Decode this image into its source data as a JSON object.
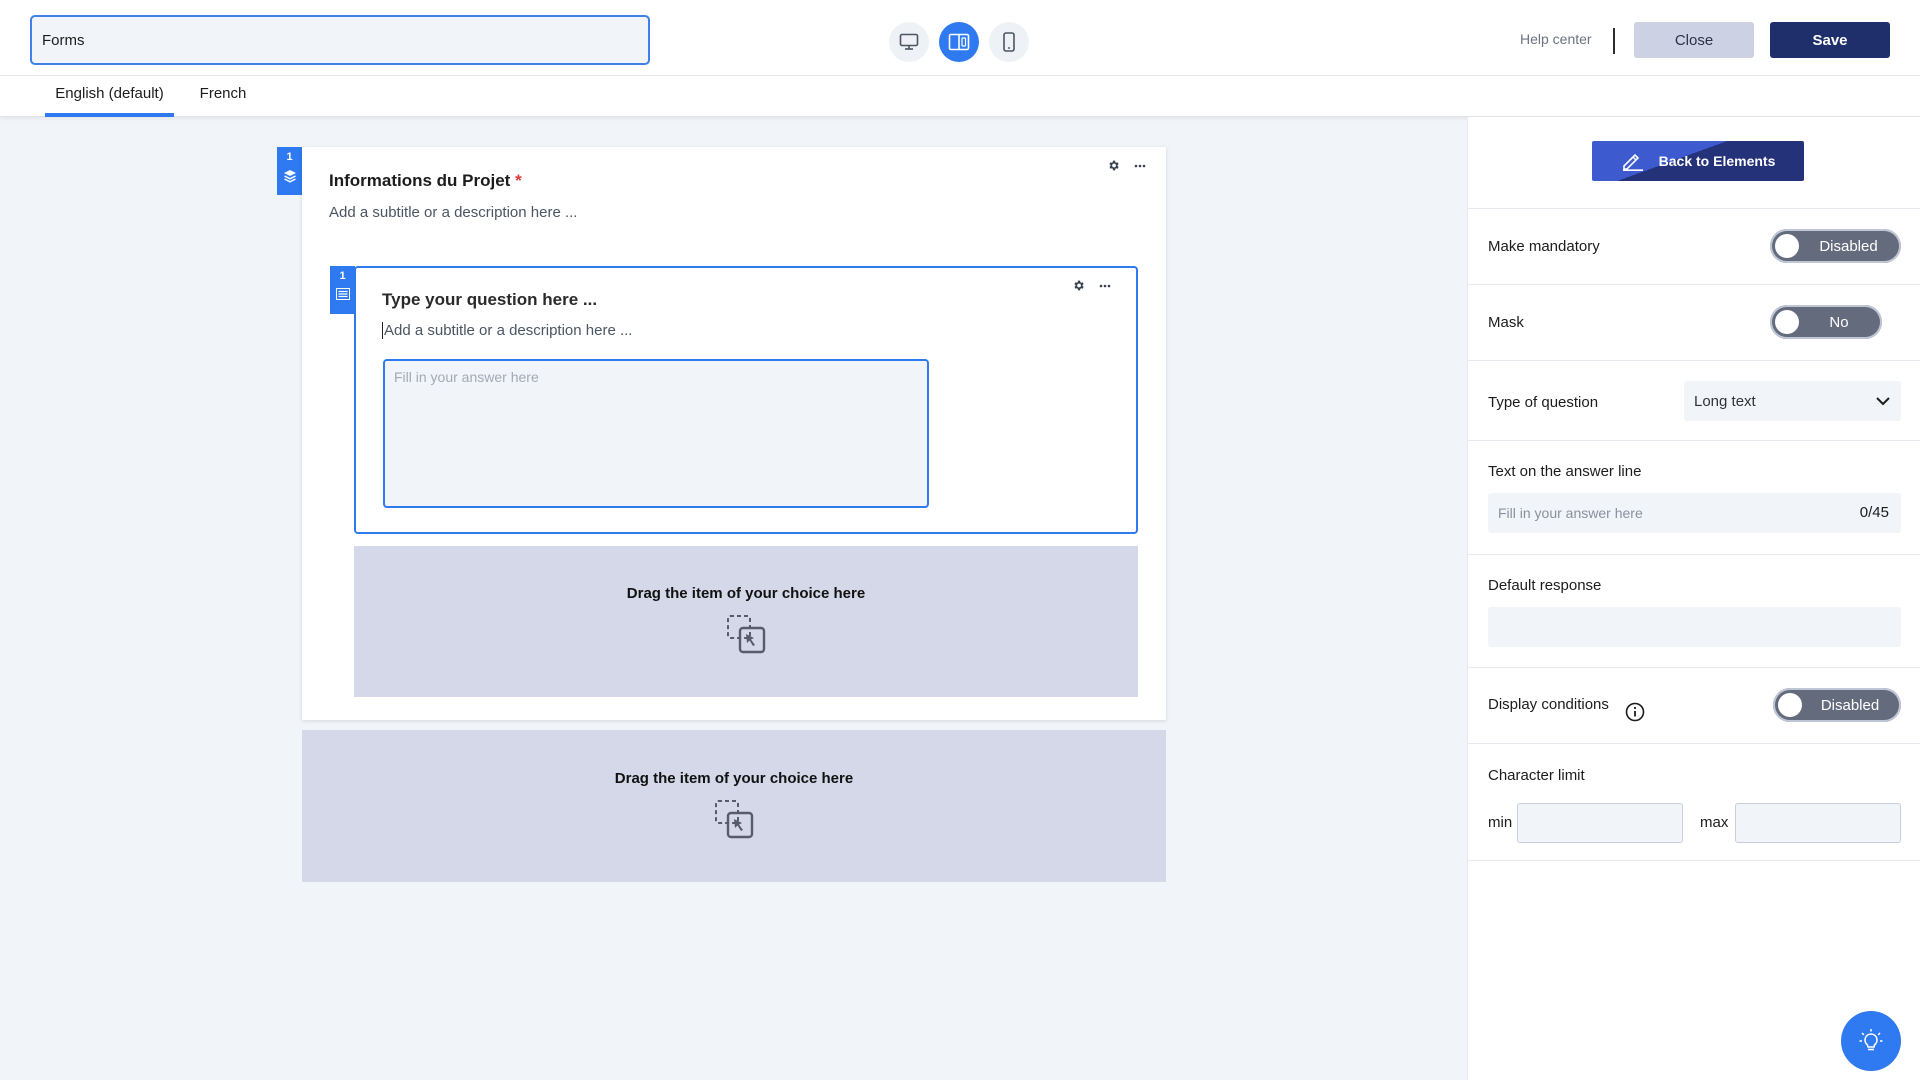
{
  "topbar": {
    "form_name": "Forms",
    "view_modes": [
      "desktop",
      "split",
      "mobile"
    ],
    "active_view": "split",
    "help_label": "Help center",
    "close_label": "Close",
    "save_label": "Save"
  },
  "languages": {
    "tabs": [
      "English (default)",
      "French"
    ],
    "active": "English (default)"
  },
  "section": {
    "number": "1",
    "title": "Informations du Projet",
    "required_mark": "*",
    "subtitle": "Add a subtitle or a description here ..."
  },
  "question": {
    "number": "1",
    "title": "Type your question here ...",
    "subtitle": "Add a subtitle or a description here ...",
    "answer_placeholder": "Fill in your answer here"
  },
  "dropzones": {
    "inner_label": "Drag the item of your choice here",
    "outer_label": "Drag the item of your choice here"
  },
  "panel": {
    "back_label": "Back to Elements",
    "mandatory": {
      "label": "Make mandatory",
      "value": "Disabled"
    },
    "mask": {
      "label": "Mask",
      "value": "No"
    },
    "question_type": {
      "label": "Type of question",
      "value": "Long text"
    },
    "answer_line": {
      "label": "Text on the answer line",
      "placeholder": "Fill in your answer here",
      "counter": "0/45"
    },
    "default_response": {
      "label": "Default response"
    },
    "display_conditions": {
      "label": "Display conditions",
      "value": "Disabled"
    },
    "char_limit": {
      "label": "Character limit",
      "min_label": "min",
      "max_label": "max"
    }
  },
  "colors": {
    "accent": "#2f7af0",
    "primary_dark": "#1e2f6b",
    "dropzone": "#d4d8e8",
    "toggle_off": "#646b7d"
  }
}
